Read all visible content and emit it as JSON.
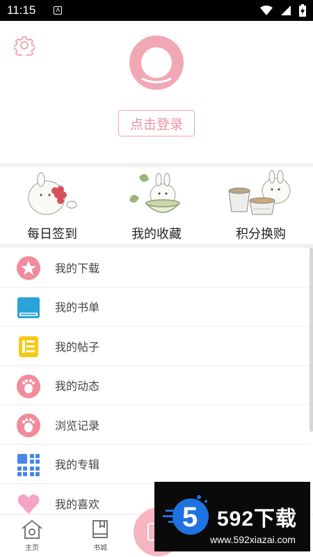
{
  "status_bar": {
    "time": "11:15",
    "notification_letter": "A",
    "icons": [
      "wifi-icon",
      "signal-icon",
      "battery-charging-icon"
    ]
  },
  "header": {
    "settings_icon": "gear-icon",
    "avatar_icon": "avatar-ring-icon",
    "login_label": "点击登录"
  },
  "features": [
    {
      "label": "每日签到",
      "icon": "daily-checkin-bunny-icon"
    },
    {
      "label": "我的收藏",
      "icon": "collection-bunny-icon"
    },
    {
      "label": "积分换购",
      "icon": "points-exchange-bunny-icon"
    }
  ],
  "menu": [
    {
      "label": "我的下载",
      "icon": "star-icon",
      "color": "#f28b9b"
    },
    {
      "label": "我的书单",
      "icon": "book-icon",
      "color": "#29a3d9"
    },
    {
      "label": "我的帖子",
      "icon": "post-icon",
      "color": "#f7c916"
    },
    {
      "label": "我的动态",
      "icon": "footprint-icon",
      "color": "#f28b9b"
    },
    {
      "label": "浏览记录",
      "icon": "footprint-icon",
      "color": "#f28b9b"
    },
    {
      "label": "我的专辑",
      "icon": "album-grid-icon",
      "color": "#4a86e8"
    },
    {
      "label": "我的喜欢",
      "icon": "heart-icon",
      "color": "#f7a3c4"
    }
  ],
  "bottom_nav": [
    {
      "label": "主页",
      "icon": "home-icon"
    },
    {
      "label": "书城",
      "icon": "bookstore-icon"
    },
    {
      "label": "",
      "icon": "center-action-icon"
    }
  ],
  "watermark": {
    "title": "592下载",
    "url": "www.592xiazai.com",
    "logo_digit": "5"
  },
  "colors": {
    "accent_pink": "#f2a7b4",
    "login_text": "#ee8fa2",
    "divider": "#f1f1f1"
  }
}
